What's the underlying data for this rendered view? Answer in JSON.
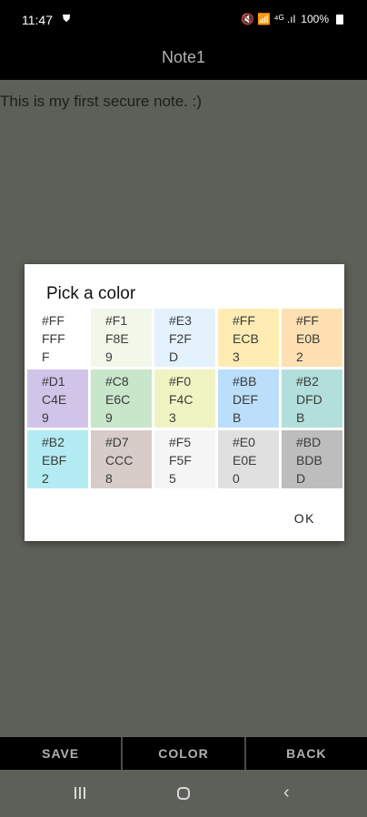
{
  "status_bar": {
    "time": "11:47",
    "indicators": "🔇 📶 ⁴ᴳ .ıl",
    "battery": "100%"
  },
  "app_bar": {
    "title": "Note1"
  },
  "note": {
    "text": "This is my first secure note. :)"
  },
  "dialog": {
    "title": "Pick a color",
    "ok_label": "OK",
    "swatches": [
      {
        "label": "#FFFFFF",
        "color": "#FFFFFF"
      },
      {
        "label": "#F1F8E9",
        "color": "#F1F8E9"
      },
      {
        "label": "#E3F2FD",
        "color": "#E3F2FD"
      },
      {
        "label": "#FFECB3",
        "color": "#FFECB3"
      },
      {
        "label": "#FFE0B2",
        "color": "#FFE0B2"
      },
      {
        "label": "#D1C4E9",
        "color": "#D1C4E9"
      },
      {
        "label": "#C8E6C9",
        "color": "#C8E6C9"
      },
      {
        "label": "#F0F4C3",
        "color": "#F0F4C3"
      },
      {
        "label": "#BBDEFB",
        "color": "#BBDEFB"
      },
      {
        "label": "#B2DFDB",
        "color": "#B2DFDB"
      },
      {
        "label": "#B2EBF2",
        "color": "#B2EBF2"
      },
      {
        "label": "#D7CCC8",
        "color": "#D7CCC8"
      },
      {
        "label": "#F5F5F5",
        "color": "#F5F5F5"
      },
      {
        "label": "#E0E0E0",
        "color": "#E0E0E0"
      },
      {
        "label": "#BDBDBD",
        "color": "#BDBDBD"
      }
    ]
  },
  "bottom_buttons": {
    "save": "SAVE",
    "color": "COLOR",
    "back": "BACK"
  },
  "nav": {
    "back_glyph": "‹"
  }
}
